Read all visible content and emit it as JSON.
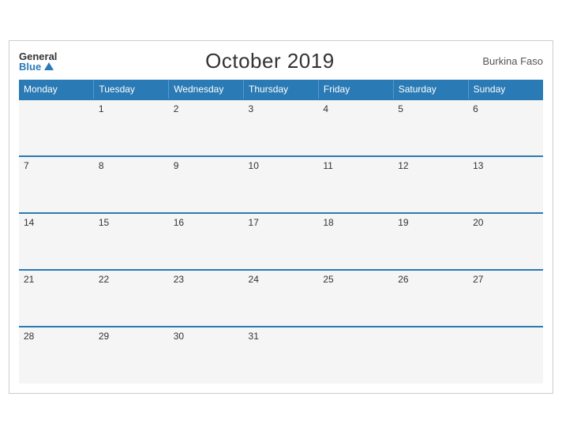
{
  "header": {
    "logo_general": "General",
    "logo_blue": "Blue",
    "title": "October 2019",
    "country": "Burkina Faso"
  },
  "days_of_week": [
    "Monday",
    "Tuesday",
    "Wednesday",
    "Thursday",
    "Friday",
    "Saturday",
    "Sunday"
  ],
  "weeks": [
    [
      "",
      "1",
      "2",
      "3",
      "4",
      "5",
      "6"
    ],
    [
      "7",
      "8",
      "9",
      "10",
      "11",
      "12",
      "13"
    ],
    [
      "14",
      "15",
      "16",
      "17",
      "18",
      "19",
      "20"
    ],
    [
      "21",
      "22",
      "23",
      "24",
      "25",
      "26",
      "27"
    ],
    [
      "28",
      "29",
      "30",
      "31",
      "",
      "",
      ""
    ]
  ]
}
